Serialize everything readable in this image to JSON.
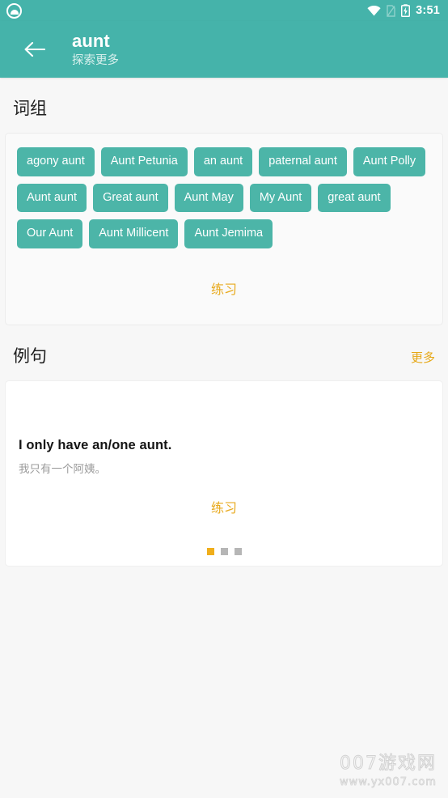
{
  "status_bar": {
    "app_icon": "cloud-icon",
    "wifi_icon": "wifi-icon",
    "sim_icon": "sim-off-icon",
    "battery_icon": "battery-charging-icon",
    "time": "3:51"
  },
  "app_bar": {
    "back_icon": "back-arrow-icon",
    "title": "aunt",
    "subtitle": "探索更多",
    "background_color": "#45b3aa"
  },
  "phrases_section": {
    "title": "词组",
    "chips": [
      "agony aunt",
      "Aunt Petunia",
      "an aunt",
      "paternal aunt",
      "Aunt Polly",
      "Aunt aunt",
      "Great aunt",
      "Aunt May",
      "My Aunt",
      "great aunt",
      "Our Aunt",
      "Aunt Millicent",
      "Aunt Jemima"
    ],
    "practice_label": "练习",
    "chip_color": "#4cb5a8",
    "accent_color": "#e8aa1e"
  },
  "examples_section": {
    "title": "例句",
    "more_label": "更多",
    "sentence_en": "I only have an/one aunt.",
    "sentence_zh": "我只有一个阿姨。",
    "practice_label": "练习",
    "dots": [
      {
        "active": true
      },
      {
        "active": false
      },
      {
        "active": false
      }
    ]
  },
  "watermark": {
    "line1": "007游戏网",
    "line2": "www.yx007.com"
  }
}
